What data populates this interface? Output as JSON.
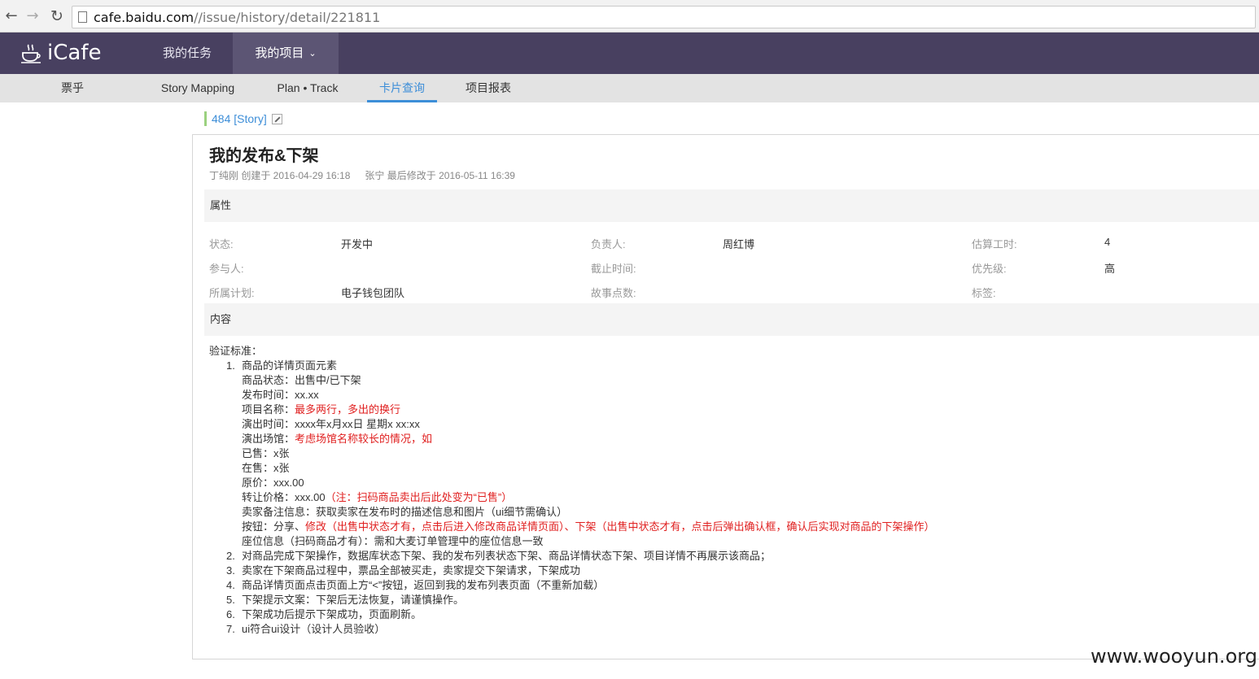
{
  "browser": {
    "url_host": "cafe.baidu.com",
    "url_path": "//issue/history/detail/221811"
  },
  "header": {
    "logo_text": "iCafe",
    "nav": [
      {
        "label": "我的任务"
      },
      {
        "label": "我的项目"
      }
    ]
  },
  "subnav": {
    "project": "票乎",
    "items": [
      {
        "label": "Story Mapping"
      },
      {
        "label": "Plan • Track"
      },
      {
        "label": "卡片查询"
      },
      {
        "label": "项目报表"
      }
    ],
    "active": "卡片查询"
  },
  "card": {
    "link": "484 [Story]",
    "title": "我的发布&下架",
    "created": "丁纯刚 创建于 2016-04-29 16:18",
    "modified": "张宁 最后修改于 2016-05-11 16:39"
  },
  "attributes": {
    "section_title": "属性",
    "rows": [
      [
        {
          "label": "状态:",
          "value": "开发中"
        },
        {
          "label": "负责人:",
          "value": "周红博"
        },
        {
          "label": "估算工时:",
          "value": "4"
        }
      ],
      [
        {
          "label": "参与人:",
          "value": ""
        },
        {
          "label": "截止时间:",
          "value": ""
        },
        {
          "label": "优先级:",
          "value": "高"
        }
      ],
      [
        {
          "label": "所属计划:",
          "value": "电子钱包团队"
        },
        {
          "label": "故事点数:",
          "value": ""
        },
        {
          "label": "标签:",
          "value": ""
        }
      ]
    ]
  },
  "content": {
    "section_title": "内容",
    "lead": "验证标准：",
    "item1_title": "商品的详情页面元素",
    "item1_lines": [
      {
        "text": "商品状态：出售中/已下架",
        "red": ""
      },
      {
        "text": "发布时间：xx.xx",
        "red": ""
      },
      {
        "text": "项目名称：",
        "red": "最多两行，多出的换行"
      },
      {
        "text": "演出时间：xxxx年x月xx日 星期x xx:xx",
        "red": ""
      },
      {
        "text": "演出场馆：",
        "red": "考虑场馆名称较长的情况，如"
      },
      {
        "text": "已售：x张",
        "red": ""
      },
      {
        "text": "在售：x张",
        "red": ""
      },
      {
        "text": "原价：xxx.00",
        "red": ""
      },
      {
        "text": "转让价格：xxx.00",
        "red": "（注：扫码商品卖出后此处变为“已售”）"
      },
      {
        "text": "卖家备注信息：获取卖家在发布时的描述信息和图片（ui细节需确认）",
        "red": ""
      },
      {
        "text": "按钮：分享、",
        "red": "修改（出售中状态才有，点击后进入修改商品详情页面）、下架（出售中状态才有，点击后弹出确认框，确认后实现对商品的下架操作）"
      },
      {
        "text": "座位信息（扫码商品才有）：需和大麦订单管理中的座位信息一致",
        "red": ""
      }
    ],
    "items": [
      {
        "num": "2.",
        "text": "对商品完成下架操作，数据库状态下架、我的发布列表状态下架、商品详情状态下架、项目详情不再展示该商品；"
      },
      {
        "num": "3.",
        "text": "卖家在下架商品过程中，票品全部被买走，卖家提交下架请求，下架成功"
      },
      {
        "num": "4.",
        "text": "商品详情页面点击页面上方“<”按钮，返回到我的发布列表页面（不重新加载）"
      },
      {
        "num": "5.",
        "text": "下架提示文案：下架后无法恢复，请谨慎操作。"
      },
      {
        "num": "6.",
        "text": "下架成功后提示下架成功，页面刷新。"
      },
      {
        "num": "7.",
        "text": "ui符合ui设计（设计人员验收）"
      }
    ]
  },
  "watermark": "www.wooyun.org"
}
